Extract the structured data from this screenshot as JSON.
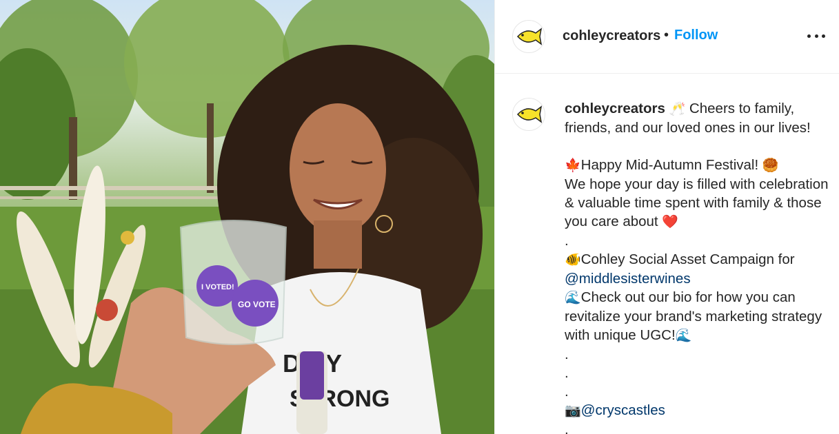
{
  "post": {
    "username": "cohleycreators",
    "separator": "•",
    "follow_label": "Follow",
    "more_icon": "more-horizontal-icon",
    "avatar_icon": "yellow-fish-icon"
  },
  "caption": {
    "username": "cohleycreators",
    "line1_emoji": "🥂",
    "line1_text": " Cheers to family, friends, and our loved ones in our lives!",
    "line2_emoji": "🍁",
    "line2_text": "Happy Mid-Autumn Festival! ",
    "line2_emoji_end": "🥮",
    "line3_text": "We hope your day is filled with celebration & valuable time spent with family & those you care about ",
    "line3_emoji_end": "❤️",
    "dot1": ".",
    "line4_emoji": "🐠",
    "line4_text": "Cohley Social Asset Campaign for",
    "line4_mention": "@middlesisterwines",
    "line5_emoji": "🌊",
    "line5_text": "Check out our bio for how you can revitalize your brand's marketing strategy with unique UGC!",
    "line5_emoji_end": "🌊",
    "dot2": ".",
    "dot3": ".",
    "dot4": ".",
    "line6_emoji": "📷",
    "line6_mention": "@cryscastles",
    "dot5": "."
  },
  "photo": {
    "glass_sticker_1": "I VOTED!",
    "glass_sticker_2": "GO VOTE",
    "shirt_line_1": "D BY",
    "shirt_line_2": "STRONG"
  },
  "colors": {
    "follow": "#0095f6",
    "mention": "#00376b",
    "fish": "#f7e22a"
  }
}
